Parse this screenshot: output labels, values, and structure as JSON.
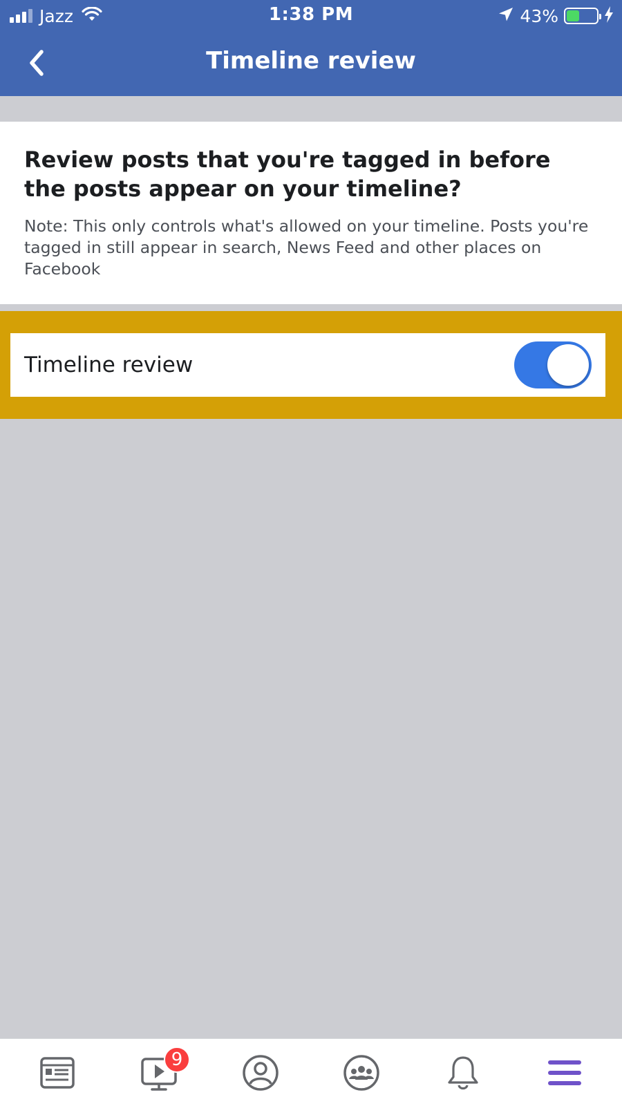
{
  "status_bar": {
    "carrier": "Jazz",
    "time": "1:38 PM",
    "battery_percent": "43%",
    "battery_level": 0.43
  },
  "header": {
    "title": "Timeline review",
    "back_icon": "chevron-left-icon"
  },
  "info": {
    "question": "Review posts that you're tagged in before the posts appear on your timeline?",
    "note": "Note: This only controls what's allowed on your timeline. Posts you're tagged in still appear in search, News Feed and other places on Facebook"
  },
  "setting": {
    "label": "Timeline review",
    "enabled": true
  },
  "tabbar": {
    "items": [
      {
        "icon": "news-feed-icon"
      },
      {
        "icon": "watch-icon",
        "badge": "9"
      },
      {
        "icon": "profile-icon"
      },
      {
        "icon": "groups-icon"
      },
      {
        "icon": "notifications-bell-icon"
      },
      {
        "icon": "menu-icon",
        "active": true
      }
    ]
  },
  "colors": {
    "header_bg": "#4267b2",
    "highlight": "#d4a006",
    "toggle_on": "#3578e5",
    "badge": "#fa3e3e",
    "active_tab": "#6f52c9"
  }
}
